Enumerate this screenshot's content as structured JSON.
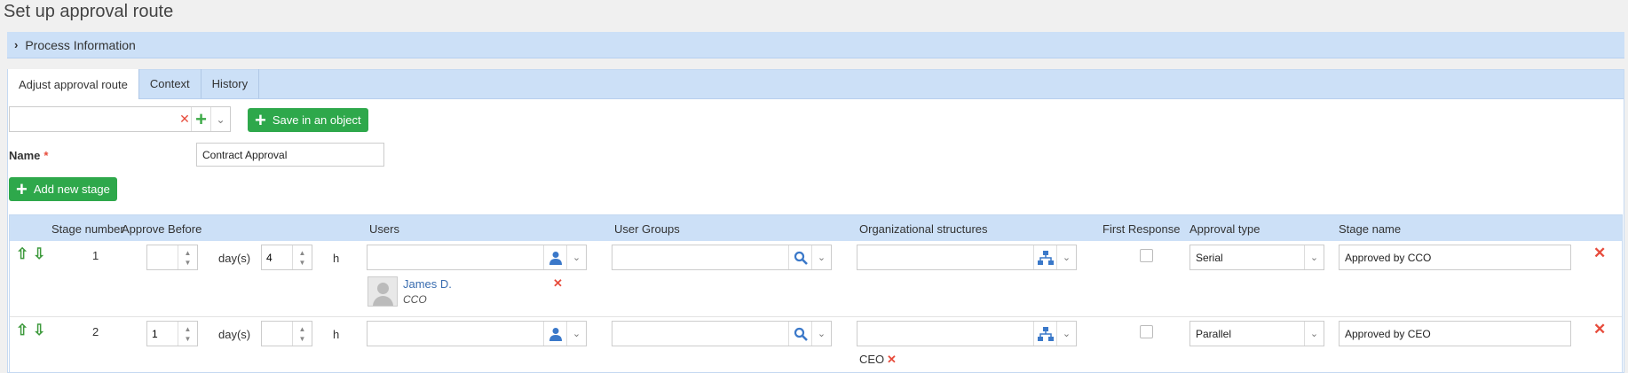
{
  "page": {
    "title": "Set up approval route"
  },
  "process_panel": {
    "label": "Process Information"
  },
  "tabs": [
    "Adjust approval route",
    "Context",
    "History"
  ],
  "toolbar": {
    "save_label": "Save in an object",
    "add_stage_label": "Add new stage"
  },
  "name_field": {
    "label": "Name",
    "value": "Contract Approval"
  },
  "columns": {
    "stage_number": "Stage number",
    "approve_before": "Approve Before",
    "users": "Users",
    "user_groups": "User Groups",
    "org_structures": "Organizational structures",
    "first_response": "First Response",
    "approval_type": "Approval type",
    "stage_name": "Stage name"
  },
  "units": {
    "days": "day(s)",
    "hours": "h"
  },
  "stages": [
    {
      "number": "1",
      "days": "",
      "hours": "4",
      "user": {
        "name": "James D.",
        "role": "CCO"
      },
      "org_tag": "",
      "first_response": false,
      "approval_type": "Serial",
      "stage_name": "Approved by CCO"
    },
    {
      "number": "2",
      "days": "1",
      "hours": "",
      "org_tag": "CEO",
      "first_response": false,
      "approval_type": "Parallel",
      "stage_name": "Approved by CEO"
    }
  ]
}
